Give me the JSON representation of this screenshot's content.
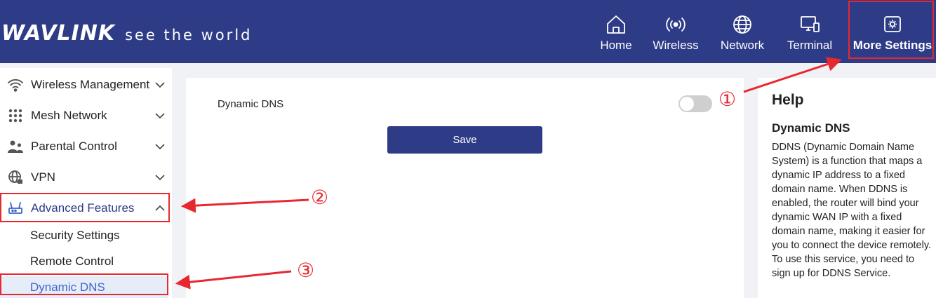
{
  "header": {
    "brand": "WAVLINK",
    "tagline": "see the world",
    "nav": [
      {
        "label": "Home",
        "icon": "home-icon"
      },
      {
        "label": "Wireless",
        "icon": "wireless-icon"
      },
      {
        "label": "Network",
        "icon": "globe-icon"
      },
      {
        "label": "Terminal",
        "icon": "terminal-icon"
      },
      {
        "label": "More Settings",
        "icon": "settings-icon",
        "active": true
      }
    ]
  },
  "sidebar": {
    "items": [
      {
        "label": "Wireless Management",
        "icon": "wifi-icon"
      },
      {
        "label": "Mesh Network",
        "icon": "mesh-grid-icon"
      },
      {
        "label": "Parental Control",
        "icon": "parental-icon"
      },
      {
        "label": "VPN",
        "icon": "vpn-globe-icon"
      },
      {
        "label": "Advanced Features",
        "icon": "router-icon",
        "expanded": true
      }
    ],
    "subitems": [
      {
        "label": "Security Settings"
      },
      {
        "label": "Remote Control"
      },
      {
        "label": "Dynamic DNS",
        "active": true
      }
    ]
  },
  "main": {
    "ddns_label": "Dynamic DNS",
    "ddns_enabled": false,
    "save_label": "Save"
  },
  "help": {
    "title": "Help",
    "subtitle": "Dynamic DNS",
    "text": "DDNS (Dynamic Domain Name System) is a function that maps a dynamic IP address to a fixed domain name. When DDNS is enabled, the router will bind your dynamic WAN IP with a fixed domain name, making it easier for you to connect the device remotely. To use this service, you need to sign up for DDNS Service."
  },
  "annotations": {
    "markers": [
      "①",
      "②",
      "③"
    ],
    "color": "#e8282f"
  },
  "colors": {
    "header_bg": "#2e3b87",
    "accent": "#2e3b87",
    "active_link": "#3f66c9",
    "annotation": "#e8282f"
  }
}
